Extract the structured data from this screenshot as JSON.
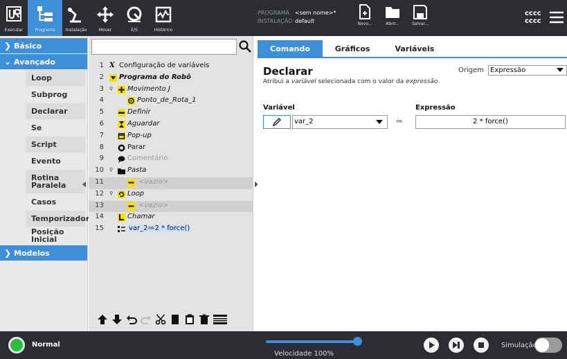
{
  "topbar": {
    "buttons": [
      {
        "label": "Executar",
        "icon": "ur-logo-icon"
      },
      {
        "label": "Programa",
        "icon": "program-tree-icon",
        "active": true
      },
      {
        "label": "Instalação",
        "icon": "robot-arm-icon"
      },
      {
        "label": "Mover",
        "icon": "move-arrows-icon"
      },
      {
        "label": "E/S",
        "icon": "io-icon"
      },
      {
        "label": "Histórico",
        "icon": "history-chart-icon"
      }
    ],
    "program_key": "PROGRAMA",
    "program_value": "<sem nome>*",
    "install_key": "INSTALAÇÃO",
    "install_value": "default",
    "file_buttons": [
      {
        "label": "Novo...",
        "icon": "new-file-icon"
      },
      {
        "label": "Abrir...",
        "icon": "open-folder-icon"
      },
      {
        "label": "Salvar...",
        "icon": "save-icon"
      }
    ],
    "user_line1": "cccc",
    "user_line2": "cccc"
  },
  "leftnav": {
    "basico": "Básico",
    "avancado": "Avançado",
    "items": [
      "Loop",
      "Subprog",
      "Declarar",
      "Se",
      "Script",
      "Evento",
      "Rotina Paralela",
      "Casos",
      "Temporizador",
      "Posição Inicial"
    ],
    "modelos": "Modelos"
  },
  "tree": {
    "rows": [
      {
        "num": "1",
        "text": "Configuração de variáveis"
      },
      {
        "num": "2",
        "text": "Programa do Robô"
      },
      {
        "num": "3",
        "text": "Movimento J"
      },
      {
        "num": "4",
        "text": "Ponto_de_Rota_1"
      },
      {
        "num": "5",
        "text": "Definir"
      },
      {
        "num": "6",
        "text": "Aguardar"
      },
      {
        "num": "7",
        "text": "Pop-up"
      },
      {
        "num": "8",
        "text": "Parar"
      },
      {
        "num": "9",
        "text": "Comentário"
      },
      {
        "num": "10",
        "text": "Pasta"
      },
      {
        "num": "11",
        "text": "<vazio>"
      },
      {
        "num": "12",
        "text": "Loop"
      },
      {
        "num": "13",
        "text": "<vazio>"
      },
      {
        "num": "14",
        "text": "Chamar"
      },
      {
        "num": "15",
        "text": "var_2≔2 * force()"
      }
    ]
  },
  "right": {
    "tabs": [
      "Comando",
      "Gráficos",
      "Variáveis"
    ],
    "title": "Declarar",
    "desc_pre": "Atribui a ",
    "desc_em1": "variável",
    "desc_mid": " selecionada com o valor da ",
    "desc_em2": "expressão",
    "desc_post": ".",
    "origem_label": "Origem",
    "origem_value": "Expressão",
    "var_label": "Variável",
    "expr_label": "Expressão",
    "var_value": "var_2",
    "assign": "≔",
    "expr_value": "2 * force()"
  },
  "bottombar": {
    "status": "Normal",
    "speed_text": "Velocidade 100%",
    "speed_fraction": 1.0,
    "sim_label": "Simulação"
  },
  "colors": {
    "accent": "#3c8fd8",
    "bar": "#2b2d33",
    "status_green": "#27c03a",
    "node_yellow": "#f5e000"
  }
}
